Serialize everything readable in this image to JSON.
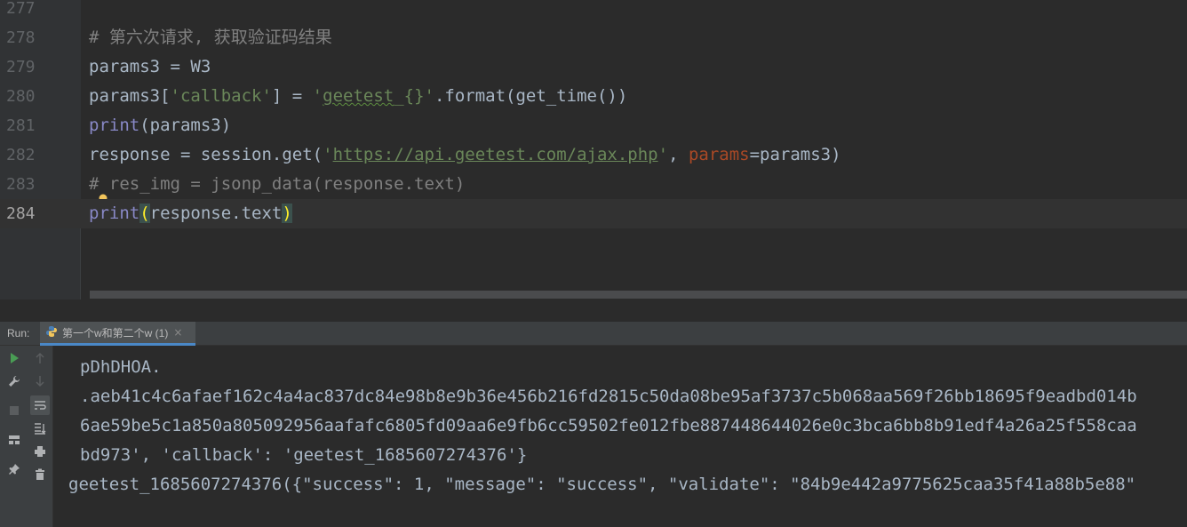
{
  "editor": {
    "lines": [
      {
        "number": "277",
        "text": ""
      },
      {
        "number": "278",
        "text": "# 第六次请求, 获取验证码结果"
      },
      {
        "number": "279",
        "text": "params3 = W3"
      },
      {
        "number": "280",
        "parts": [
          "params3[",
          "'callback'",
          "] = ",
          "'",
          "geetest",
          "_{}'",
          ".format(get_time())"
        ]
      },
      {
        "number": "281",
        "parts": [
          "print",
          "(params3)"
        ]
      },
      {
        "number": "282",
        "parts": [
          "response = session.get(",
          "'",
          "https://api.geetest.com/ajax.php",
          "'",
          ", ",
          "params",
          "=params3)"
        ]
      },
      {
        "number": "283",
        "parts": [
          "#",
          " res_img = jsonp_data(response.text)"
        ]
      },
      {
        "number": "284",
        "parts": [
          "print",
          "(",
          "response.text",
          ")"
        ]
      }
    ],
    "current_line": "284",
    "colors": {
      "background": "#2b2b2b",
      "comment": "#808080",
      "builtin": "#8888c6",
      "string": "#6a8759",
      "keyword_arg": "#aa4926",
      "default": "#a9b7c6"
    }
  },
  "run": {
    "label": "Run:",
    "tab": {
      "title": "第一个w和第二个w (1)",
      "close": "×",
      "icon": "python-icon"
    },
    "toolbar_icons": [
      "rerun-icon",
      "up-arrow-icon",
      "wrench-icon",
      "down-arrow-icon",
      "stop-icon",
      "soft-wrap-icon",
      "scroll-to-end-icon",
      "layout-icon",
      "print-icon",
      "pin-icon",
      "trash-icon"
    ],
    "output_lines": [
      "pDhDHOA.",
      ".aeb41c4c6afaef162c4a4ac837dc84e98b8e9b36e456b216fd2815c50da08be95af3737c5b068aa569f26bb18695f9eadbd014b",
      "6ae59be5c1a850a805092956aafafc6805fd09aa6e9fb6cc59502fe012fbe887448644026e0c3bca6bb8b91edf4a26a25f558caa",
      "bd973', 'callback': 'geetest_1685607274376'}",
      "geetest_1685607274376({\"success\": 1, \"message\": \"success\", \"validate\": \"84b9e442a9775625caa35f41a88b5e88\""
    ]
  }
}
